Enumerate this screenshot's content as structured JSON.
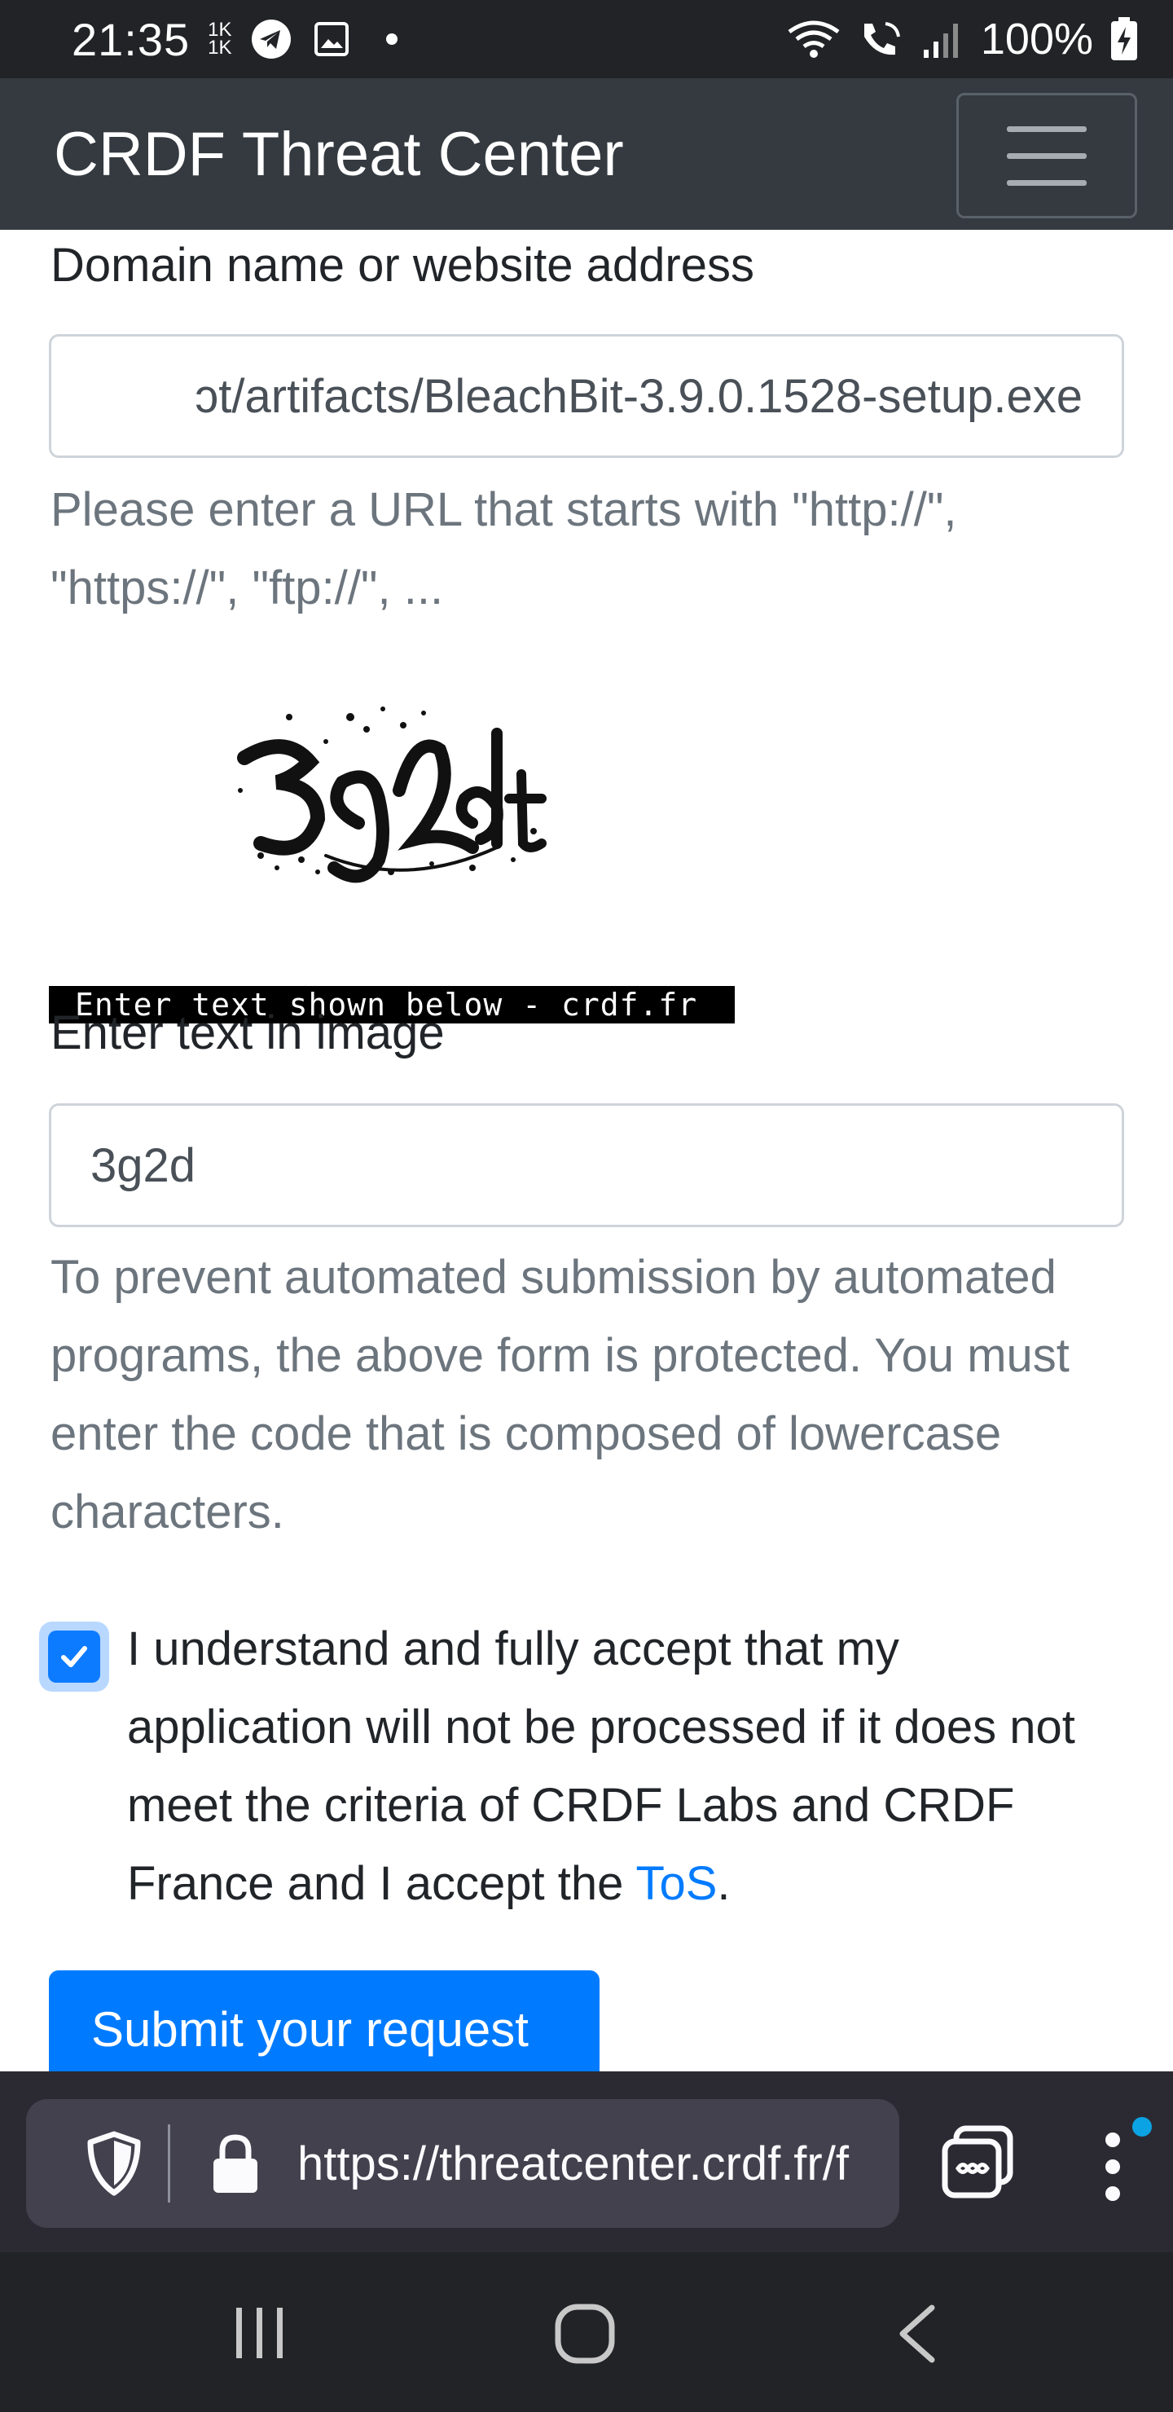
{
  "status_bar": {
    "time": "21:35",
    "small_top": "1K",
    "small_bottom": "1K",
    "battery": "100%",
    "icons": [
      "telegram-icon",
      "gallery-icon",
      "dot-icon",
      "wifi-icon",
      "volte-call-icon",
      "signal-icon",
      "battery-charging-icon"
    ]
  },
  "navbar": {
    "brand": "CRDF Threat Center"
  },
  "form": {
    "domain_label": "Domain name or website address",
    "domain_value": "ɔt/artifacts/BleachBit-3.9.0.1528-setup.exe",
    "domain_help": "Please enter a URL that starts with \"http://\", \"https://\", \"ftp://\", ...",
    "captcha_caption": "Enter text shown below - crdf.fr",
    "captcha_label": "Enter text in image",
    "captcha_value": "3g2d",
    "captcha_help": "To prevent automated submission by automated programs, the above form is protected. You must enter the code that is composed of lowercase characters.",
    "terms_checked": true,
    "terms_text": "I understand and fully accept that my application will not be processed if it does not meet the criteria of CRDF Labs and CRDF France and I accept the",
    "terms_link": "ToS",
    "terms_end": ".",
    "submit_label": "Submit your request"
  },
  "browser": {
    "url": "https://threatcenter.crdf.fr/f",
    "accent": "#0ba3e4"
  },
  "colors": {
    "primary": "#007bff",
    "navbar": "#343a40",
    "muted": "#6c757d"
  }
}
